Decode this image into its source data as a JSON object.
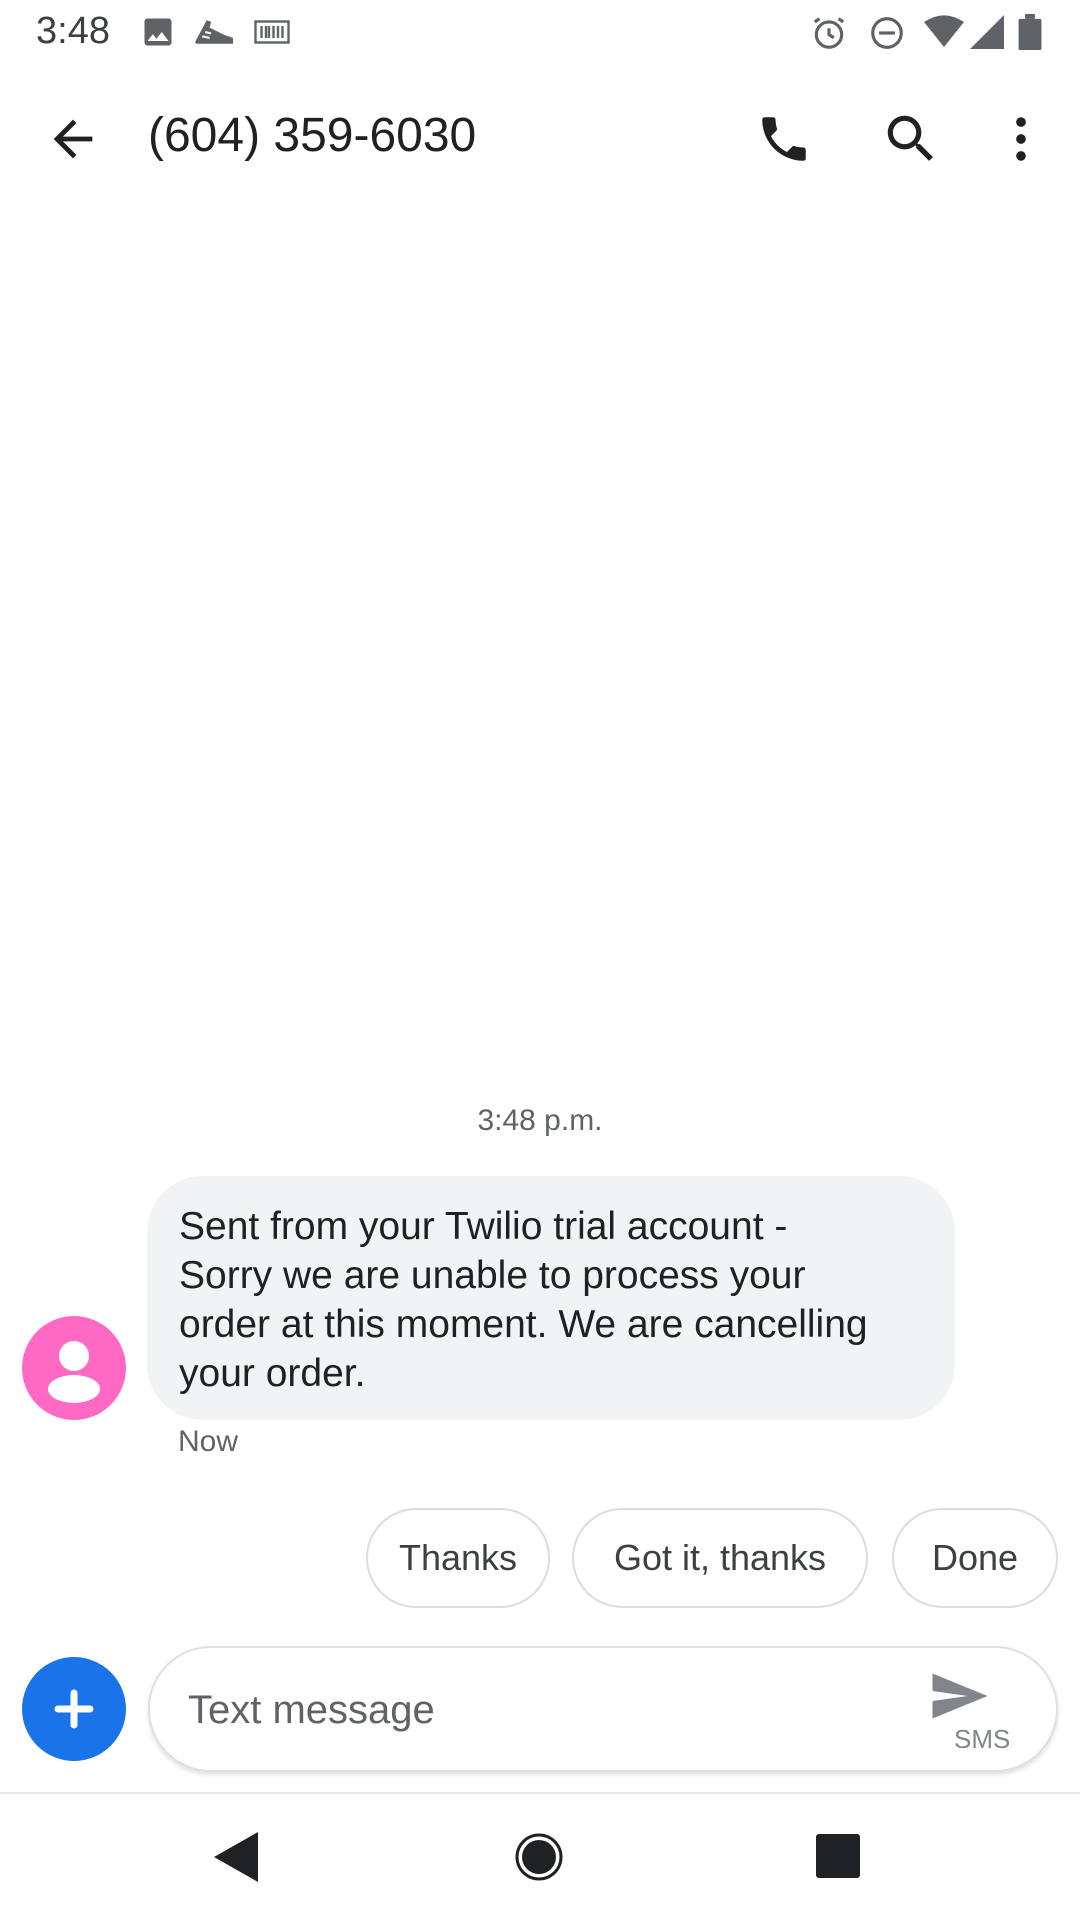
{
  "status_bar": {
    "time": "3:48",
    "left_icons": [
      "image-icon",
      "shoe-icon",
      "barcode-icon"
    ],
    "right_icons": [
      "alarm-icon",
      "do-not-disturb-icon",
      "wifi-icon",
      "signal-icon",
      "battery-icon"
    ]
  },
  "toolbar": {
    "title": "(604) 359-6030",
    "icons": [
      "back-arrow-icon",
      "phone-icon",
      "search-icon",
      "more-vert-icon"
    ]
  },
  "conversation": {
    "timestamp": "3:48 p.m.",
    "message": {
      "lines": [
        "Sent from your Twilio trial account -",
        "Sorry we are unable to process your",
        "order at this moment. We are cancelling",
        "your order."
      ],
      "status": "Now"
    }
  },
  "smart_replies": [
    "Thanks",
    "Got it, thanks",
    "Done"
  ],
  "compose": {
    "placeholder": "Text message",
    "send_label": "SMS"
  },
  "colors": {
    "accent": "#1a73e8",
    "avatar": "#ff69c4",
    "bubble": "#f1f3f4"
  }
}
